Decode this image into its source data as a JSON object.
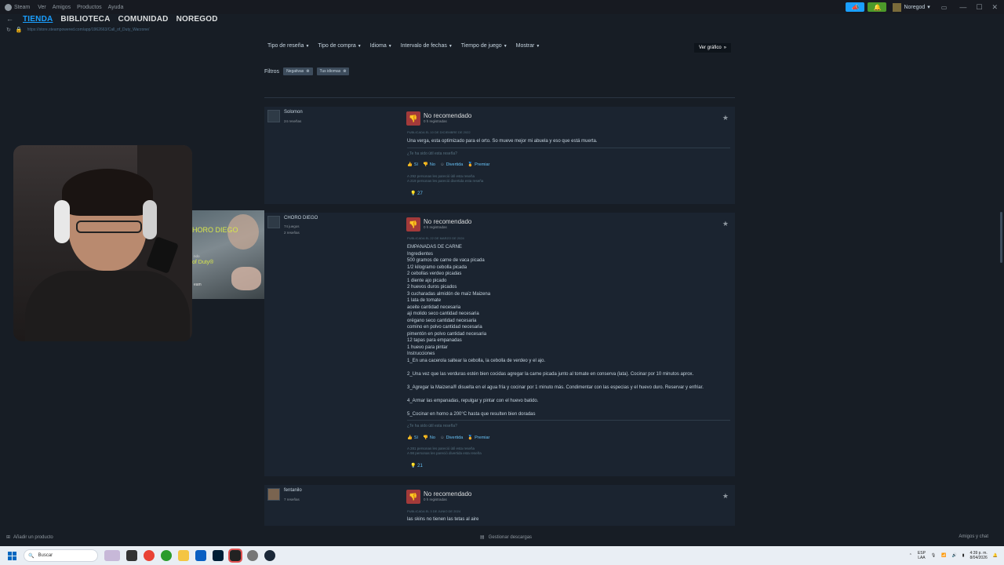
{
  "titlebar": {
    "app": "Steam",
    "menu": [
      "Ver",
      "Amigos",
      "Productos",
      "Ayuda"
    ],
    "user": "Noregod",
    "window_controls": [
      "minimize-icon",
      "maximize-icon",
      "close-icon"
    ]
  },
  "nav": {
    "tabs": [
      "TIENDA",
      "BIBLIOTECA",
      "COMUNIDAD",
      "NOREGOD"
    ],
    "url": "https://store.steampowered.com/app/1962663/Call_of_Duty_Warzone/"
  },
  "filters": {
    "items": [
      "Tipo de reseña",
      "Tipo de compra",
      "Idioma",
      "Intervalo de fechas",
      "Tiempo de juego",
      "Mostrar"
    ],
    "graph_button": "Ver gráfico",
    "label": "Filtros",
    "chips": [
      "Negativas",
      "Tus idiomas"
    ]
  },
  "reviews": [
    {
      "user": "Solomon",
      "stats": "24 reseñas",
      "verdict": "No recomendado",
      "hours": "0 h registradas",
      "posted": "PUBLICADA EL 10 DE DICIEMBRE DE 2022",
      "body": "Una verga, esta optimizado para el orto. So mueve mejor mi abuela y eso que está muerta.",
      "helpful_q": "¿Te ha sido útil esta reseña?",
      "buttons": [
        "Sí",
        "No",
        "Divertida",
        "Premiar"
      ],
      "found": "A 292 personas les pareció útil esta reseña",
      "found_funny": "A 219 personas les pareció divertida esta reseña",
      "awards": "27"
    },
    {
      "user": "CHORO DIEGO",
      "stats": "74 juegos",
      "stats2": "2 reseñas",
      "verdict": "No recomendado",
      "hours": "0 h registradas",
      "posted": "PUBLICADA EL 22 DE MARZO DE 2024",
      "body": "EMPANADAS DE CARNE\nIngredientes\n500 gramos de carne de vaca picada\n1/2 kilogramo cebolla picada\n2 cebollas verdeo picadas\n1 diente ajo picado\n2 huevos duros picados\n3 cucharadas almidón de maíz Maizena\n1 lata de tomate\naceite cantidad necesaria\naji molido seco cantidad necesaria\norégano seco cantidad necesaria\ncomino en polvo cantidad necesaria\npimentón en polvo cantidad necesaria\n12 tapas para empanadas\n1 huevo para pintar\nInstrucciones\n1_En una cacerola saltear la cebolla, la cebolla de verdeo y el ajo.\n\n2_Una vez que las verduras estén bien cocidas agregar la carne picada junto al tomate en conserva (lata). Cocinar por 10 minutos aprox.\n\n3_Agregar la Maizena® disuelta en el agua fría y cocinar por 1 minuto más. Condimentar con las especias y el huevo duro. Reservar y enfriar.\n\n4_Armar las empanadas, repulgar y pintar con el huevo batido.\n\n5_Cocinar en horno a 200°C hasta que resulten bien doradas",
      "helpful_q": "¿Te ha sido útil esta reseña?",
      "buttons": [
        "Sí",
        "No",
        "Divertida",
        "Premiar"
      ],
      "found": "A 281 personas les pareció útil esta reseña",
      "found_funny": "A 98 personas les pareció divertida esta reseña",
      "awards": "21"
    },
    {
      "user": "fentanilo",
      "stats": "7 reseñas",
      "verdict": "No recomendado",
      "hours": "0 h registradas",
      "posted": "PUBLICADA EL 3 DE JUNIO DE 2024",
      "body": "las skins no tienen las tetas al aire"
    }
  ],
  "overlay": {
    "game_title": "HORO DIEGO",
    "game_sub": "ndo",
    "game_name": "of Duty®",
    "game_foot": "eam"
  },
  "bottom": {
    "add_product": "Añadir un producto",
    "downloads": "Gestionar descargas",
    "friends": "Amigos y chat"
  },
  "taskbar": {
    "search": "Buscar",
    "lang": "ESP",
    "lang2": "LAA",
    "time": "4:39 p. m.",
    "date": "8/04/2026"
  },
  "colors": {
    "accent": "#1a9fff",
    "negative": "#a33a3a",
    "background": "#171d25"
  }
}
